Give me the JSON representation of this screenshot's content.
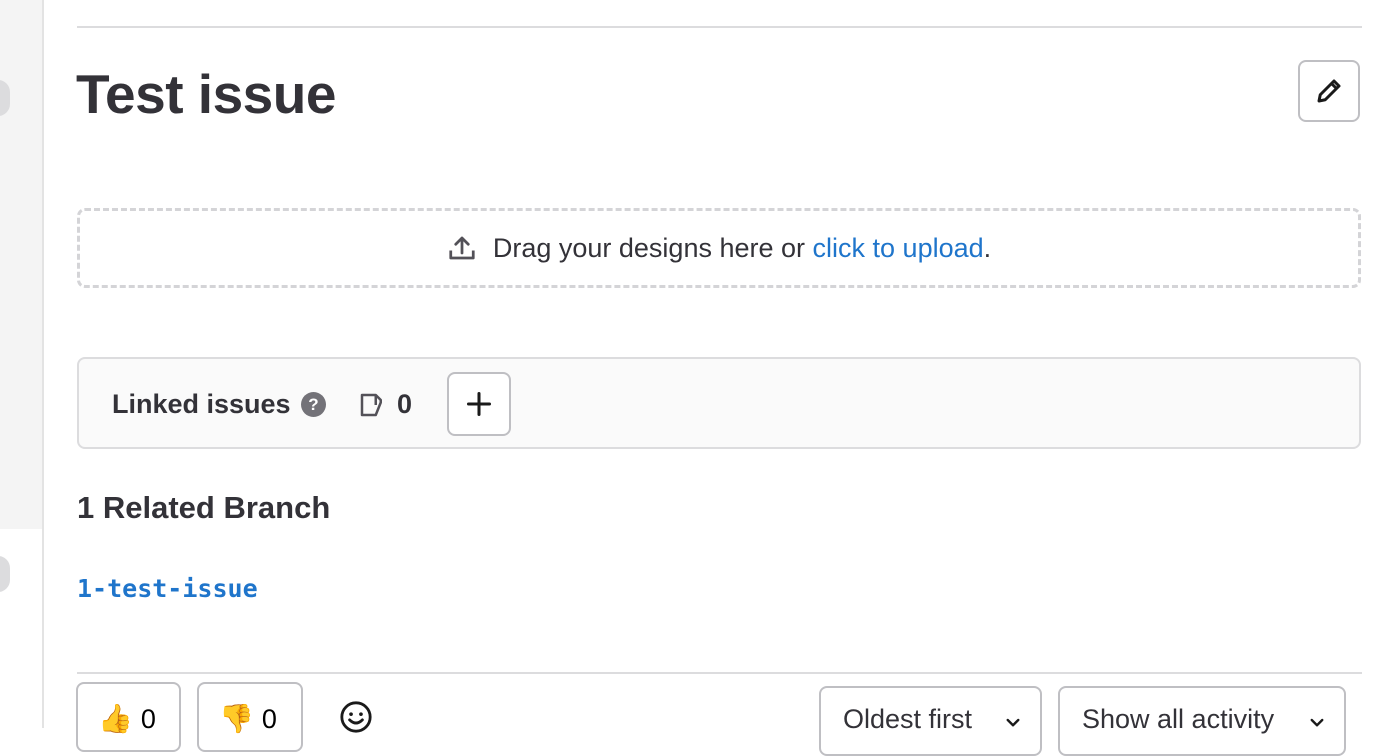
{
  "issue": {
    "title": "Test issue"
  },
  "design_upload": {
    "prompt": "Drag your designs here or",
    "link_text": "click to upload",
    "suffix": "."
  },
  "linked_issues": {
    "label": "Linked issues",
    "help_glyph": "?",
    "count": "0"
  },
  "related_branches": {
    "heading": "1 Related Branch",
    "branches": [
      "1-test-issue"
    ]
  },
  "awards": {
    "thumbs_up": {
      "emoji": "👍",
      "count": "0"
    },
    "thumbs_down": {
      "emoji": "👎",
      "count": "0"
    }
  },
  "activity": {
    "sort_label": "Oldest first",
    "filter_label": "Show all activity"
  },
  "icons": [
    "pencil-icon",
    "upload-icon",
    "question-circle-icon",
    "issues-icon",
    "plus-icon",
    "smiley-icon",
    "chevron-down-icon"
  ],
  "colors": {
    "link": "#1f75cb",
    "text": "#333238",
    "border": "#dcdcde"
  }
}
